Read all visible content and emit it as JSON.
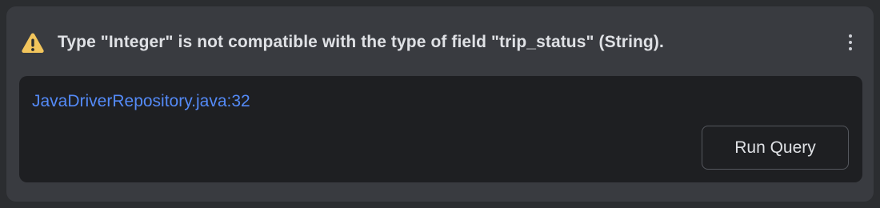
{
  "notification": {
    "severity_icon": "warning-triangle-icon",
    "warning_color": "#f2c55c",
    "message": "Type \"Integer\" is not compatible with the type of field \"trip_status\" (String).",
    "more_icon": "vertical-ellipsis-icon"
  },
  "details": {
    "source_link": "JavaDriverRepository.java:32",
    "link_color": "#548af7",
    "run_button_label": "Run Query"
  }
}
